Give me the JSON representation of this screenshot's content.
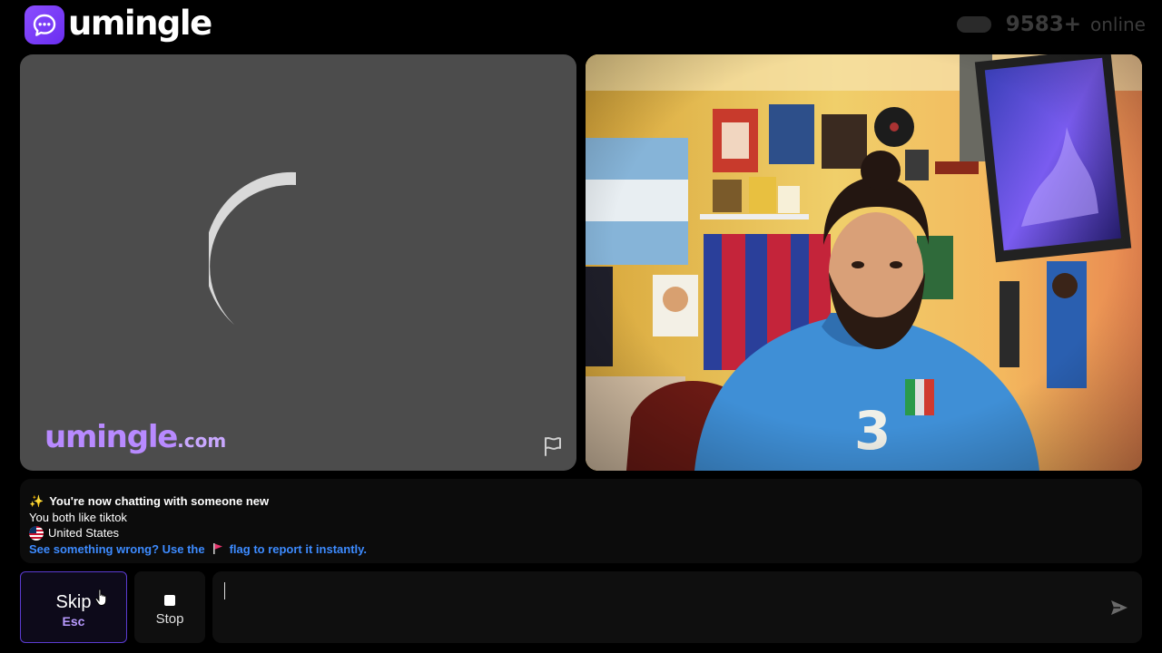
{
  "app": {
    "name": "umingle",
    "brand_color": "#7c3aed"
  },
  "header": {
    "online_count": "9583+",
    "online_label": "online"
  },
  "stranger_panel": {
    "watermark_main": "umingle",
    "watermark_suffix": ".com",
    "report_icon": "flag-icon",
    "state": "loading"
  },
  "self_panel": {
    "description": "local webcam video feed"
  },
  "chat": {
    "new_chat_emoji": "✨",
    "new_chat_text": "You're now chatting with someone new",
    "shared_interest": "You both like tiktok",
    "country": "United States",
    "report_text_before": "See something wrong? Use the",
    "report_text_after": "flag to report it instantly."
  },
  "controls": {
    "skip_label": "Skip",
    "skip_shortcut": "Esc",
    "stop_label": "Stop",
    "message_placeholder": "",
    "send_icon": "send-icon"
  }
}
